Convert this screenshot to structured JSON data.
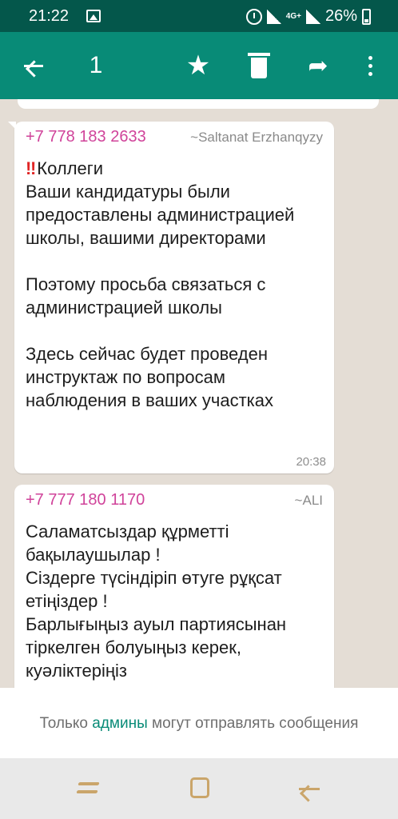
{
  "status_bar": {
    "time": "21:22",
    "network": "4G+",
    "battery": "26%",
    "icons": [
      "image-icon",
      "alarm-icon",
      "signal-icon",
      "battery-icon"
    ]
  },
  "app_bar": {
    "selected_count": "1",
    "actions": [
      "back-arrow-icon",
      "star-icon",
      "trash-icon",
      "forward-icon",
      "more-vert-icon"
    ],
    "color": "#088b77",
    "status_color": "#04574b"
  },
  "messages": [
    {
      "phone": "+7 778 183 2633",
      "pushname": "~Saltanat Erzhanqyzy",
      "prefix": "‼",
      "text_first_line": "Коллеги",
      "text": "Ваши кандидатуры были предоставлены администрацией школы, вашими директорами\n\nПоэтому просьба связаться с администрацией школы\n\nЗдесь сейчас будет проведен инструктаж по вопросам наблюдения в ваших участках",
      "time": "20:38"
    },
    {
      "phone": "+7 777 180 1170",
      "pushname": "~ALI",
      "text": "Саламатсыздар құрметті бақылаушылар !\nСіздерге түсіндіріп өтуге рұқсат етіңіздер !\nБарлығыңыз ауыл партиясынан тіркелген болуыңыз керек, куәліктеріңіз"
    }
  ],
  "footer": {
    "before": "Только ",
    "link": "админы",
    "after": " могут отправлять сообщения",
    "link_color": "#088b77"
  },
  "accent_phone_color": "#d0439a"
}
